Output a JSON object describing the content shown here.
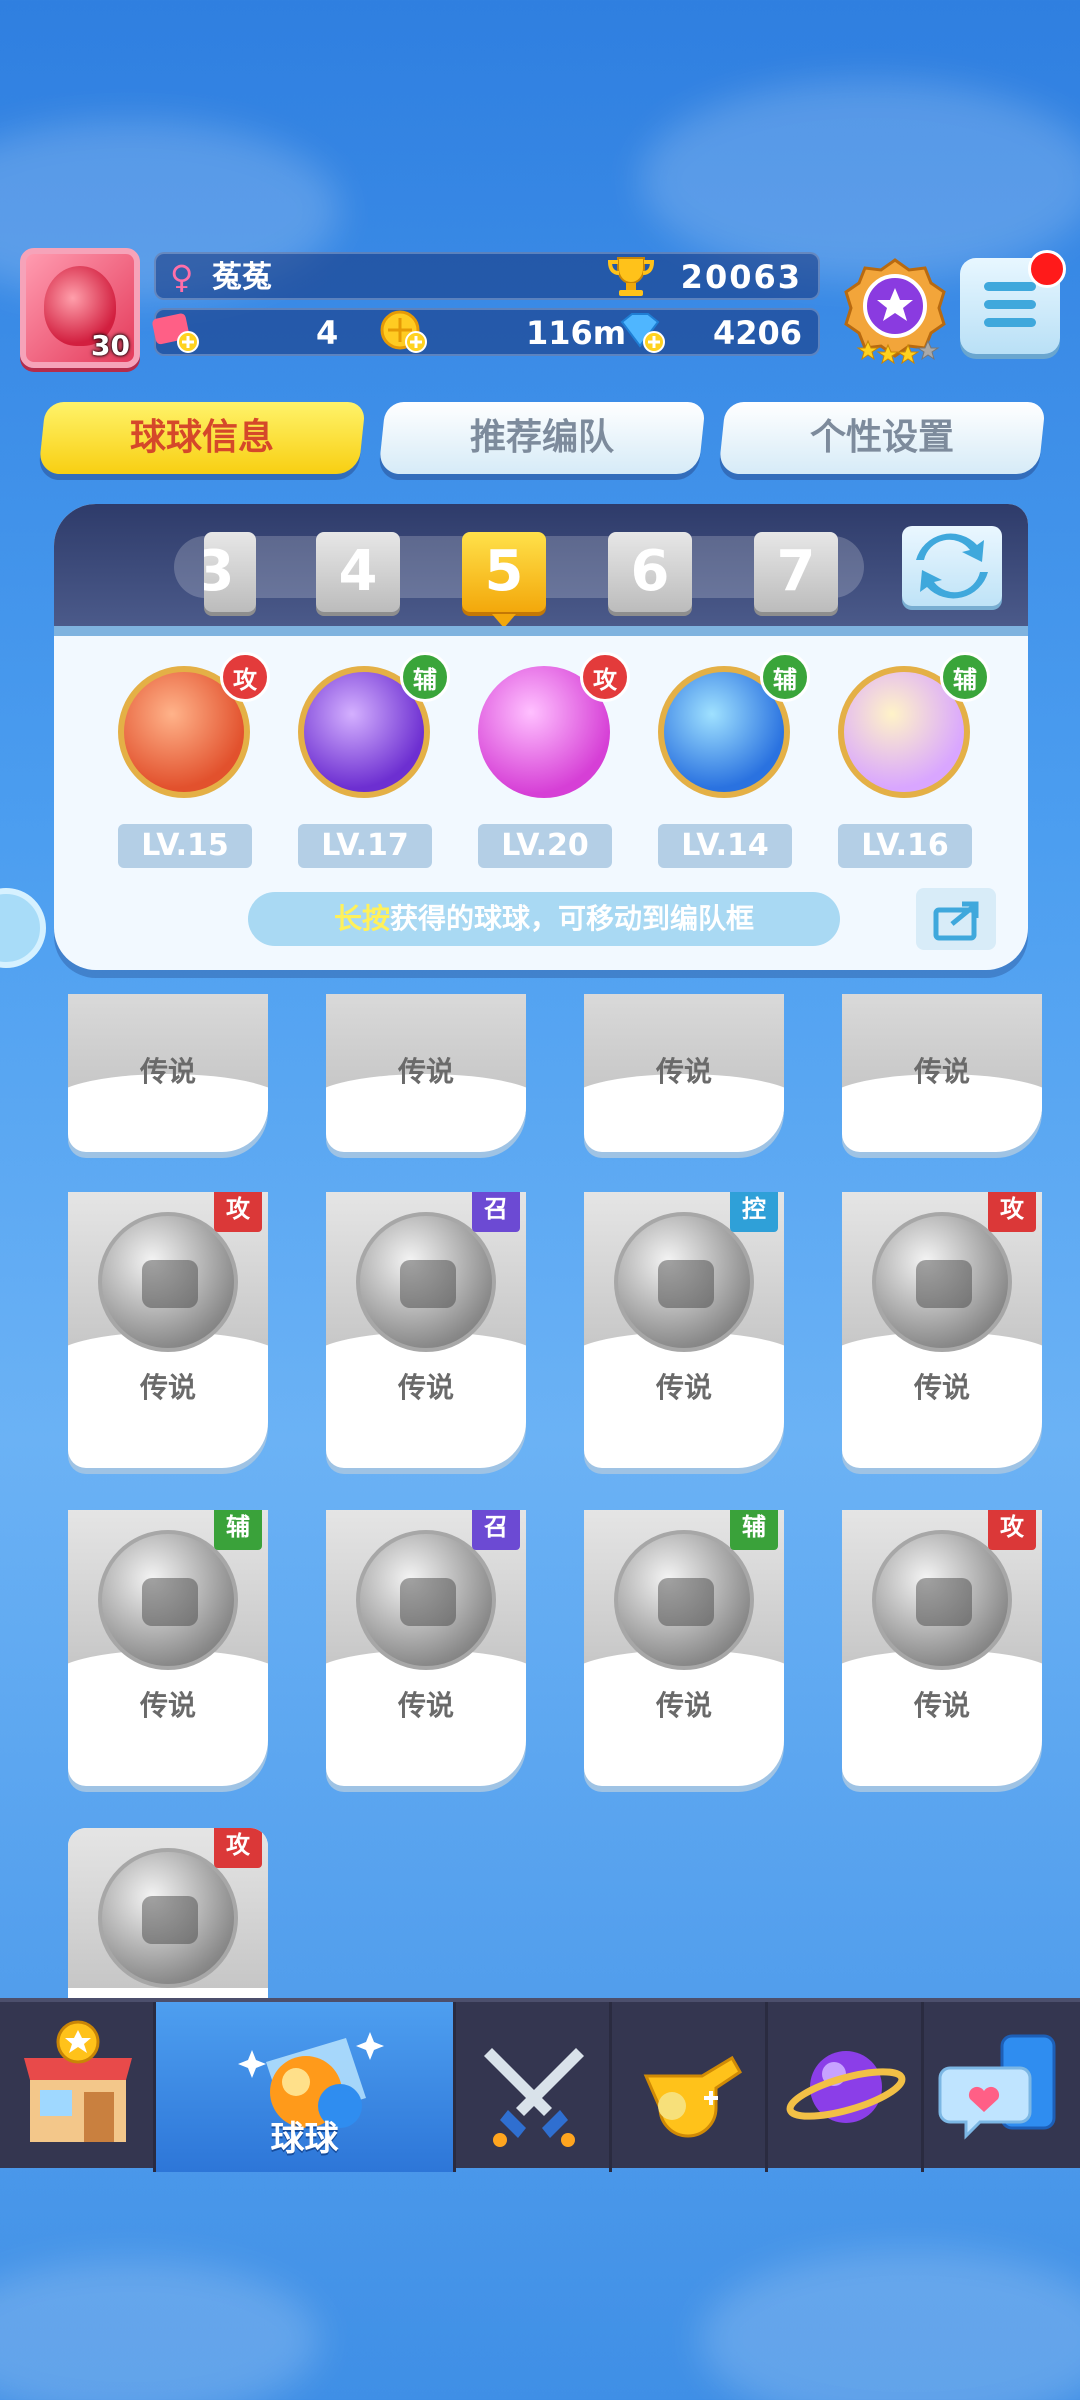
{
  "player": {
    "level": "30",
    "name": "菟菟",
    "trophies": "20063",
    "tickets": "4",
    "coins": "116m",
    "diamonds": "4206"
  },
  "tabs": [
    {
      "label": "球球信息",
      "active": true
    },
    {
      "label": "推荐编队",
      "active": false
    },
    {
      "label": "个性设置",
      "active": false
    }
  ],
  "team": {
    "slots": [
      "3",
      "4",
      "5",
      "6",
      "7"
    ],
    "active_slot": "5",
    "balls": [
      {
        "tag": "攻",
        "level": "LV.15",
        "icon": "infinity-ball-icon"
      },
      {
        "tag": "辅",
        "level": "LV.17",
        "icon": "lightning-ball-icon"
      },
      {
        "tag": "攻",
        "level": "LV.20",
        "icon": "shield-ball-icon"
      },
      {
        "tag": "辅",
        "level": "LV.14",
        "icon": "hexagon-ball-icon"
      },
      {
        "tag": "辅",
        "level": "LV.16",
        "icon": "crowd-ball-icon"
      }
    ],
    "hint_highlight": "长按",
    "hint_text": "获得的球球，可移动到编队框"
  },
  "grid": {
    "rarity": "传说",
    "rows": [
      [
        {
          "tag": ""
        },
        {
          "tag": ""
        },
        {
          "tag": ""
        },
        {
          "tag": ""
        }
      ],
      [
        {
          "tag": "攻"
        },
        {
          "tag": "召"
        },
        {
          "tag": "控"
        },
        {
          "tag": "攻"
        }
      ],
      [
        {
          "tag": "辅"
        },
        {
          "tag": "召"
        },
        {
          "tag": "辅"
        },
        {
          "tag": "攻"
        }
      ],
      [
        {
          "tag": "攻"
        }
      ]
    ]
  },
  "nav": {
    "active_label": "球球",
    "items": [
      "shop-icon",
      "balls-icon",
      "battle-swords-icon",
      "whistle-icon",
      "planet-icon",
      "chat-icon"
    ]
  },
  "colors": {
    "tag_attack": "#db3838",
    "tag_support": "#3aa23a",
    "tag_summon": "#6c4ad3",
    "tag_control": "#2fa0d8",
    "accent_yellow": "#f8cf12"
  }
}
